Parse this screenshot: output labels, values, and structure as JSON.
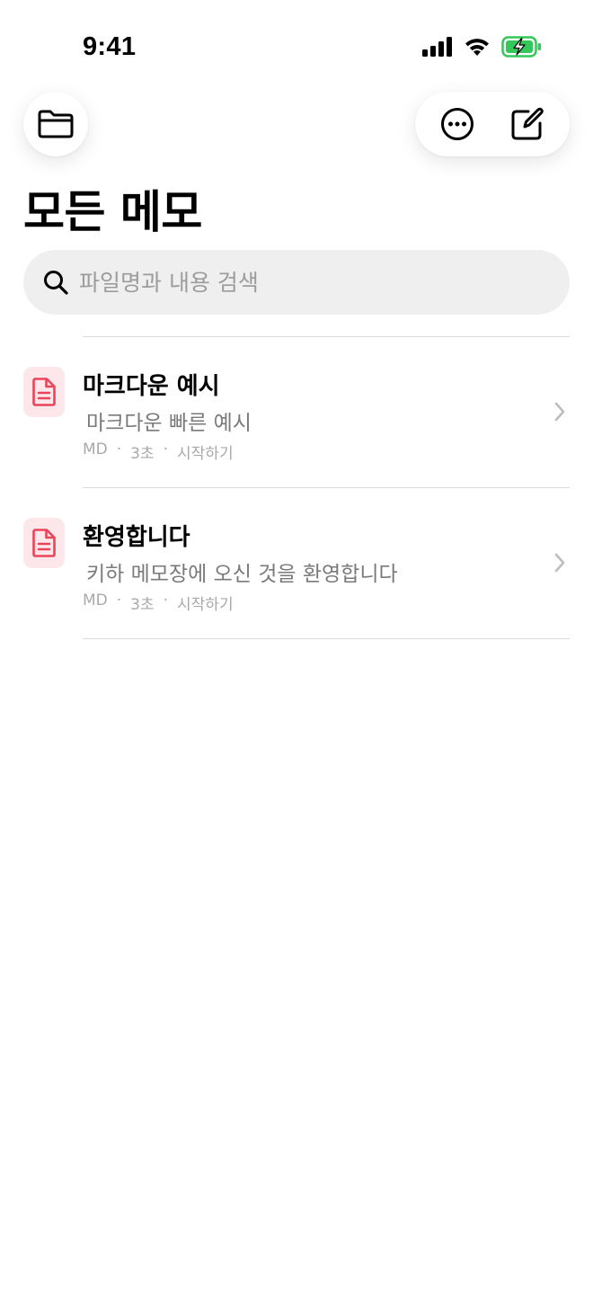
{
  "status_bar": {
    "time": "9:41",
    "icons": [
      "signal-icon",
      "wifi-icon",
      "battery-charging-icon"
    ]
  },
  "toolbar": {
    "folder_icon": "folder-icon",
    "more_icon": "ellipsis-circle-icon",
    "compose_icon": "compose-icon"
  },
  "header": {
    "title": "모든 메모"
  },
  "search": {
    "placeholder": "파일명과 내용 검색",
    "value": ""
  },
  "notes": [
    {
      "title": "마크다운 예시",
      "preview": "마크다운 빠른 예시",
      "format": "MD",
      "time": "3초",
      "folder": "시작하기"
    },
    {
      "title": "환영합니다",
      "preview": "키하 메모장에 오신 것을 환영합니다",
      "format": "MD",
      "time": "3초",
      "folder": "시작하기"
    }
  ],
  "meta_separator": "·",
  "colors": {
    "accent": "#e8455a",
    "icon_bg": "#fde7ea",
    "search_bg": "#efefef",
    "battery": "#34c759"
  }
}
